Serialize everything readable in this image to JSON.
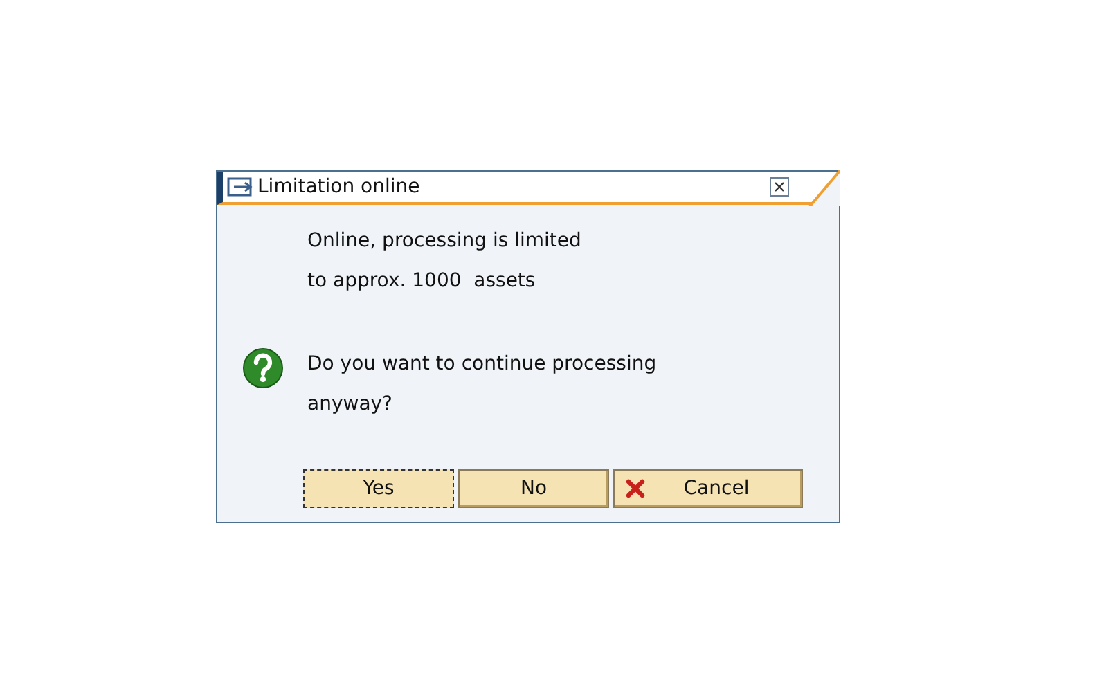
{
  "dialog": {
    "title": "Limitation online",
    "message_lines": [
      "Online, processing is limited",
      "to approx. 1000  assets"
    ],
    "question_lines": [
      "Do you want to continue processing",
      "anyway?"
    ],
    "buttons": [
      {
        "label": "Yes",
        "kind": "plain",
        "focused": true
      },
      {
        "label": "No",
        "kind": "plain",
        "focused": false
      },
      {
        "label": "Cancel",
        "kind": "cancel",
        "focused": false
      }
    ]
  }
}
